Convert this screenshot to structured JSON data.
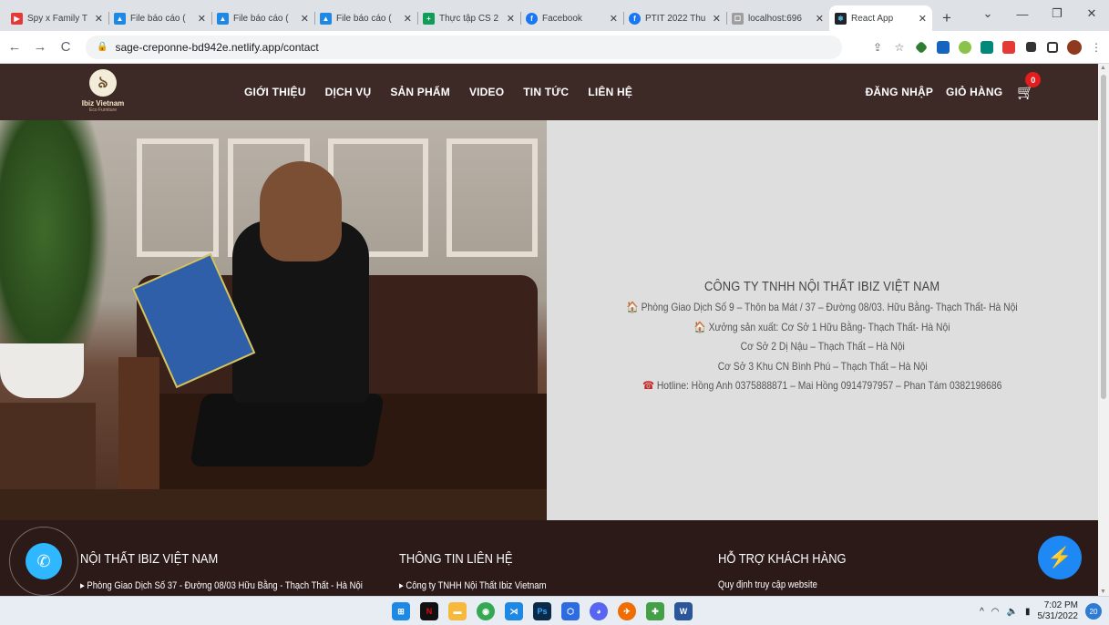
{
  "browser": {
    "tabs": [
      {
        "title": "Spy x Family T",
        "favicon_color": "#e53935",
        "favicon_glyph": "▶"
      },
      {
        "title": "File báo cáo (",
        "favicon_color": "#1e88e5",
        "favicon_glyph": "▲"
      },
      {
        "title": "File báo cáo (",
        "favicon_color": "#1e88e5",
        "favicon_glyph": "▲"
      },
      {
        "title": "File báo cáo (",
        "favicon_color": "#1e88e5",
        "favicon_glyph": "▲"
      },
      {
        "title": "Thực tập CS 2",
        "favicon_color": "#0f9d58",
        "favicon_glyph": "+"
      },
      {
        "title": "Facebook",
        "favicon_color": "#1877f2",
        "favicon_glyph": "f"
      },
      {
        "title": "PTIT 2022 Thu",
        "favicon_color": "#1877f2",
        "favicon_glyph": "f"
      },
      {
        "title": "localhost:696",
        "favicon_color": "#9e9e9e",
        "favicon_glyph": "☐"
      },
      {
        "title": "React App",
        "favicon_color": "#20232a",
        "favicon_glyph": "⚛"
      }
    ],
    "tab_close_glyph": "✕",
    "new_tab_glyph": "+",
    "window_controls": {
      "dropdown": "⌄",
      "minimize": "—",
      "restore": "❐",
      "close": "✕"
    },
    "nav": {
      "back": "←",
      "forward": "→",
      "reload": "C"
    },
    "url": "sage-creponne-bd942e.netlify.app/contact",
    "lock_glyph": "🔒",
    "toolbar_icons": {
      "share": "⇪",
      "star": "☆",
      "menu": "⋮"
    },
    "extension_colors": [
      "#2e7d32",
      "#1565c0",
      "#8bc34a",
      "#00897b",
      "#e53935",
      "#333333",
      "#333333",
      "#8d3a1e"
    ]
  },
  "site": {
    "logo": {
      "glyph": "৯",
      "name": "Ibiz Vietnam",
      "subtitle": "Eco Furniture"
    },
    "nav": [
      "GIỚI THIỆU",
      "DỊCH VỤ",
      "SẢN PHẨM",
      "VIDEO",
      "TIN TỨC",
      "LIÊN HỆ"
    ],
    "login_label": "ĐĂNG NHẬP",
    "cart_label": "GIỎ HÀNG",
    "cart_glyph": "🛒",
    "cart_count": "0",
    "contact": {
      "company": "CÔNG TY TNHH NỘI THẤT IBIZ VIỆT NAM",
      "office": "Phòng Giao Dịch Số 9 – Thôn ba Mát / 37 – Đường 08/03. Hữu Bằng- Thạch Thất- Hà Nội",
      "workshop": "Xưởng sản xuất: Cơ Sở 1 Hữu Bằng- Thạch Thất- Hà Nội",
      "branch2": "Cơ Sở 2 Dị Nậu – Thạch Thất – Hà Nội",
      "branch3": "Cơ Sở 3 Khu CN Bình Phú – Thạch Thất – Hà Nội",
      "hotline": "Hotline: Hồng Anh 0375888871 – Mai Hồng  0914797957 – Phan Tám 0382198686",
      "home_icon": "🏠",
      "phone_icon": "☎"
    },
    "footer": {
      "col1_title": "NỘI THẤT IBIZ VIỆT NAM",
      "col1_item": "Phòng Giao Dịch Số 37 - Đường 08/03 Hữu Bằng - Thạch Thất - Hà Nội",
      "col2_title": "THÔNG TIN LIÊN HỆ",
      "col2_item": "Công ty TNHH Nội Thất Ibiz Vietnam",
      "col3_title": "HỖ TRỢ KHÁCH HÀNG",
      "col3_item": "Quy định truy cập website",
      "bullet": "▸"
    },
    "call_glyph": "✆",
    "messenger_glyph": "⚡"
  },
  "taskbar": {
    "apps": [
      {
        "name": "windows",
        "color": "#1e88e5",
        "glyph": "⊞"
      },
      {
        "name": "netflix",
        "color": "#111111",
        "glyph": "N"
      },
      {
        "name": "explorer",
        "color": "#f6b93b",
        "glyph": "▬"
      },
      {
        "name": "chrome",
        "color": "#34a853",
        "glyph": "◉"
      },
      {
        "name": "vscode",
        "color": "#1e88e5",
        "glyph": "⋊"
      },
      {
        "name": "photoshop",
        "color": "#0b2a4a",
        "glyph": "Ps"
      },
      {
        "name": "app-hex",
        "color": "#2d6ce0",
        "glyph": "⬡"
      },
      {
        "name": "discord",
        "color": "#5865f2",
        "glyph": "◕"
      },
      {
        "name": "postman",
        "color": "#ef6c00",
        "glyph": "✈"
      },
      {
        "name": "app-green",
        "color": "#43a047",
        "glyph": "✚"
      },
      {
        "name": "word",
        "color": "#2b579a",
        "glyph": "W"
      }
    ],
    "tray": {
      "chevron": "^",
      "wifi": "◠",
      "volume": "🔈",
      "battery": "▮"
    },
    "time": "7:02 PM",
    "date": "5/31/2022",
    "notifications": "20"
  }
}
